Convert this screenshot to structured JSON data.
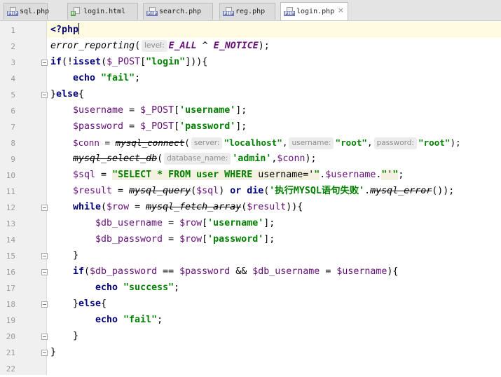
{
  "tabs": [
    {
      "name": "sql.php",
      "icon": "PHP",
      "active": false
    },
    {
      "name": "login.html",
      "icon": "H",
      "active": false
    },
    {
      "name": "search.php",
      "icon": "PHP",
      "active": false
    },
    {
      "name": "reg.php",
      "icon": "PHP",
      "active": false
    },
    {
      "name": "login.php",
      "icon": "PHP",
      "active": true
    }
  ],
  "close_glyph": "×",
  "line_numbers": [
    "1",
    "2",
    "3",
    "4",
    "5",
    "6",
    "7",
    "8",
    "9",
    "10",
    "11",
    "12",
    "13",
    "14",
    "15",
    "16",
    "17",
    "18",
    "19",
    "20",
    "21",
    "22"
  ],
  "code": {
    "l1": "<?php",
    "l2": {
      "fn": "error_reporting",
      "open": "(",
      "hint": "level:",
      "c1": "E_ALL",
      "op": " ^ ",
      "c2": "E_NOTICE",
      "close": ");"
    },
    "l3": {
      "kw1": "if",
      "p1": "(!",
      "kw2": "isset",
      "p2": "(",
      "var": "$_POST",
      "b1": "[",
      "str": "\"login\"",
      "p3": "])){"
    },
    "l4": {
      "kw": "echo",
      "str": "\"fail\"",
      "end": ";"
    },
    "l5": {
      "p1": "}",
      "kw": "else",
      "p2": "{"
    },
    "l6": {
      "var1": "$username",
      "op": " = ",
      "var2": "$_POST",
      "b1": "[",
      "str": "'username'",
      "b2": "];"
    },
    "l7": {
      "var1": "$password",
      "op": " = ",
      "var2": "$_POST",
      "b1": "[",
      "str": "'password'",
      "b2": "];"
    },
    "l8": {
      "var1": "$conn",
      "op": " = ",
      "fn": "mysql_connect",
      "open": "(",
      "h1": "server:",
      "s1": "\"localhost\"",
      "c1": ",",
      "h2": "username:",
      "s2": "\"root\"",
      "c2": ",",
      "h3": "password:",
      "s3": "\"root\"",
      "close": ");"
    },
    "l9": {
      "fn": "mysql_select_db",
      "open": "(",
      "hint": "database_name:",
      "str": "'admin'",
      "c": ",",
      "var": "$conn",
      "close": ");"
    },
    "l10": {
      "var1": "$sql",
      "op": " = ",
      "s1a": "\"SELECT * FROM user WHERE ",
      "s1b": "username='",
      "s1c": "\"",
      "dot1": ".",
      "var2": "$username",
      "dot2": ".",
      "s2a": "\"",
      "s2b": "'",
      "s2c": "\"",
      "end": ";"
    },
    "l11": {
      "var1": "$result",
      "op": " = ",
      "fn": "mysql_query",
      "open": "(",
      "var2": "$sql",
      "close": ")",
      "kw1": "or",
      "kw2": "die",
      "open2": "(",
      "str": "'执行MYSQL语句失败'",
      "dot": ".",
      "fn2": "mysql_error",
      "close2": "());"
    },
    "l12": {
      "kw": "while",
      "open": "(",
      "var1": "$row",
      "op": " = ",
      "fn": "mysql_fetch_array",
      "open2": "(",
      "var2": "$result",
      "close": ")){"
    },
    "l13": {
      "var1": "$db_username",
      "op": " = ",
      "var2": "$row",
      "b1": "[",
      "str": "'username'",
      "b2": "];"
    },
    "l14": {
      "var1": "$db_password",
      "op": " = ",
      "var2": "$row",
      "b1": "[",
      "str": "'password'",
      "b2": "];"
    },
    "l15": "}",
    "l16": {
      "kw": "if",
      "open": "(",
      "v1": "$db_password",
      "op1": " == ",
      "v2": "$password",
      "op2": " && ",
      "v3": "$db_username",
      "op3": " = ",
      "v4": "$username",
      "close": "){"
    },
    "l17": {
      "kw": "echo",
      "str": "\"success\"",
      "end": ";"
    },
    "l18": {
      "p1": "}",
      "kw": "else",
      "p2": "{"
    },
    "l19": {
      "kw": "echo",
      "str": "\"fail\"",
      "end": ";"
    },
    "l20": "}",
    "l21": "}"
  }
}
